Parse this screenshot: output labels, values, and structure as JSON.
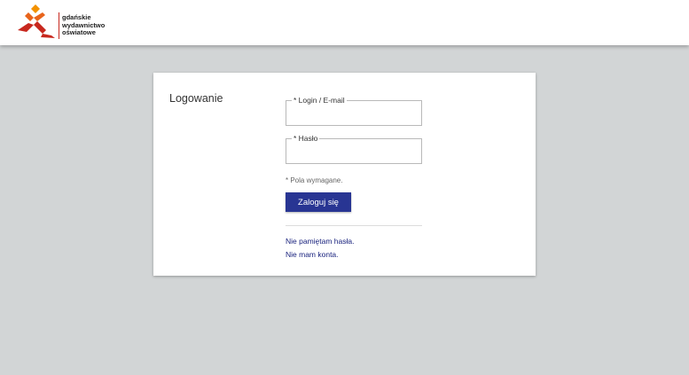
{
  "header": {
    "logo_lines": [
      "gdańskie",
      "wydawnictwo",
      "oświatowe"
    ]
  },
  "login": {
    "title": "Logowanie",
    "login_label": "* Login / E-mail",
    "login_value": "",
    "password_label": "* Hasło",
    "password_value": "",
    "required_note": "* Pola wymagane.",
    "submit_label": "Zaloguj się",
    "forgot_link": "Nie pamiętam hasła.",
    "no_account_link": "Nie mam konta."
  },
  "colors": {
    "background": "#d2d5d6",
    "primary_button": "#283593",
    "link": "#1a237e",
    "logo_orange": "#f39200",
    "logo_red": "#c8281e"
  }
}
